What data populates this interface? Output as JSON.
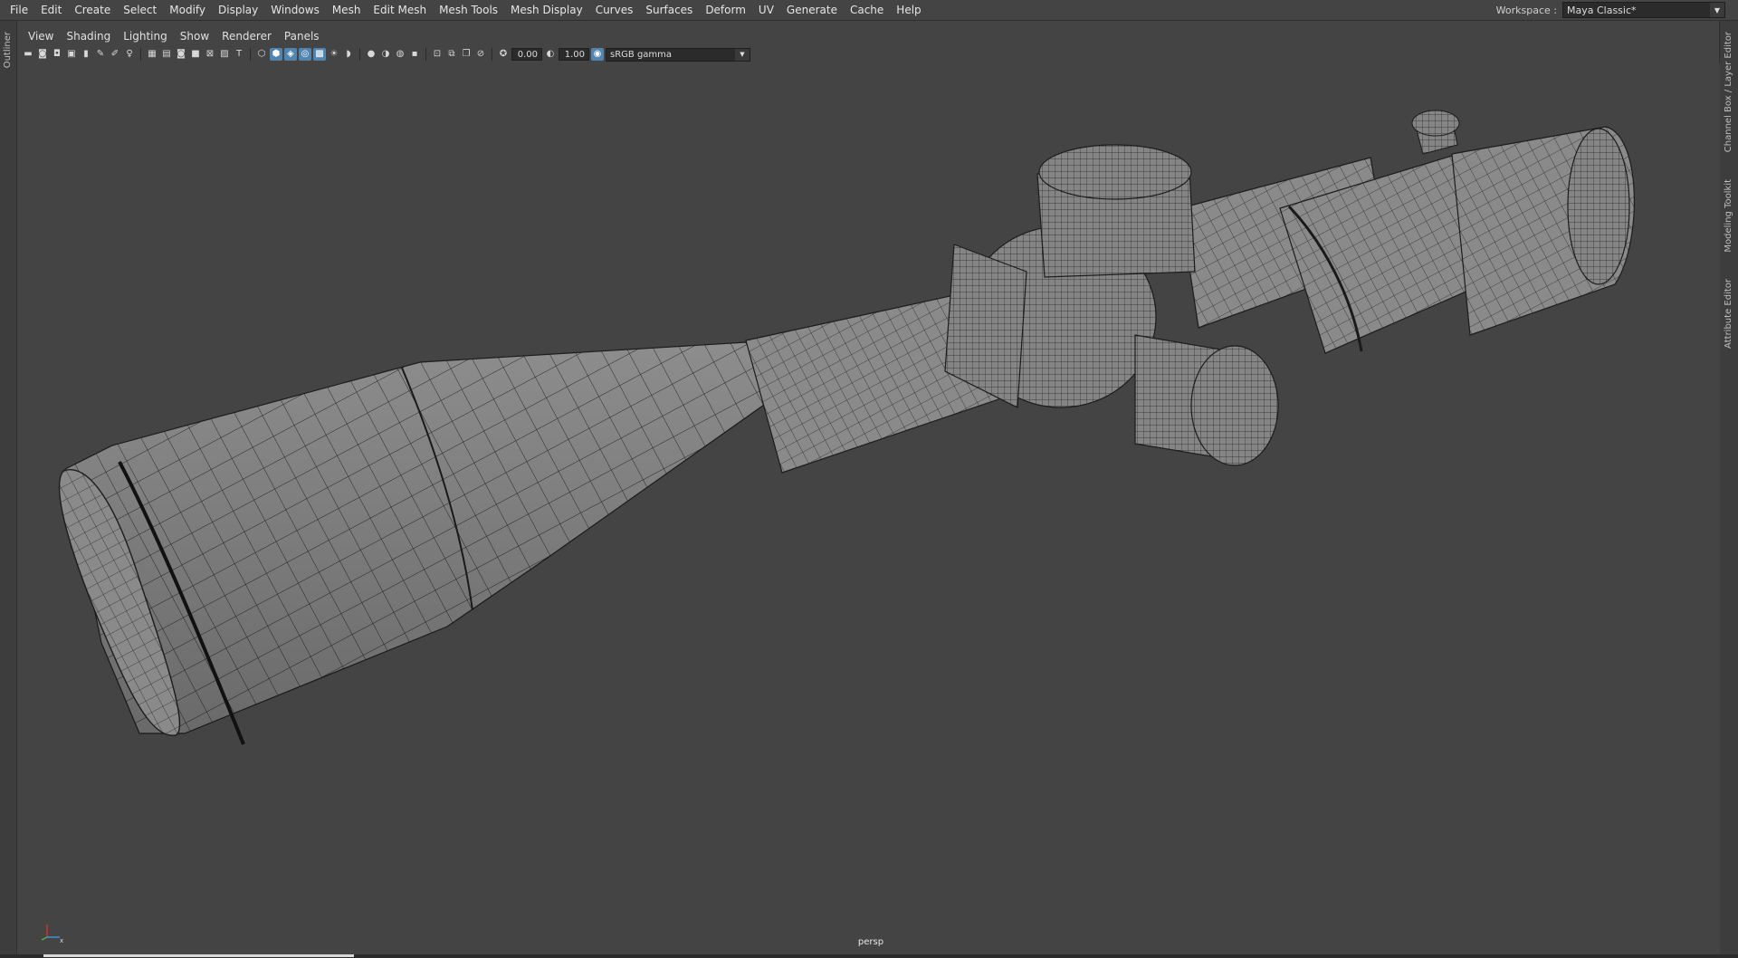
{
  "menubar": {
    "items": [
      "File",
      "Edit",
      "Create",
      "Select",
      "Modify",
      "Display",
      "Windows",
      "Mesh",
      "Edit Mesh",
      "Mesh Tools",
      "Mesh Display",
      "Curves",
      "Surfaces",
      "Deform",
      "UV",
      "Generate",
      "Cache",
      "Help"
    ]
  },
  "workspace": {
    "label": "Workspace :",
    "value": "Maya Classic*"
  },
  "left_tabs": {
    "outliner": "Outliner"
  },
  "right_tabs": {
    "channel_box": "Channel Box / Layer Editor",
    "modeling_toolkit": "Modeling Toolkit",
    "attribute_editor": "Attribute Editor"
  },
  "panel_menu": {
    "items": [
      "View",
      "Shading",
      "Lighting",
      "Show",
      "Renderer",
      "Panels"
    ]
  },
  "toolbar": {
    "exposure": "0.00",
    "gamma": "1.00",
    "color_space": "sRGB gamma"
  },
  "viewport": {
    "camera": "persp"
  },
  "icons": {
    "camera": "camera-icon",
    "wireframe": "wireframe-shaded-icon",
    "grid": "grid-icon",
    "light": "light-icon"
  },
  "colors": {
    "accent": "#5284b0",
    "bg": "#444444",
    "mesh": "#8a8a8a"
  }
}
